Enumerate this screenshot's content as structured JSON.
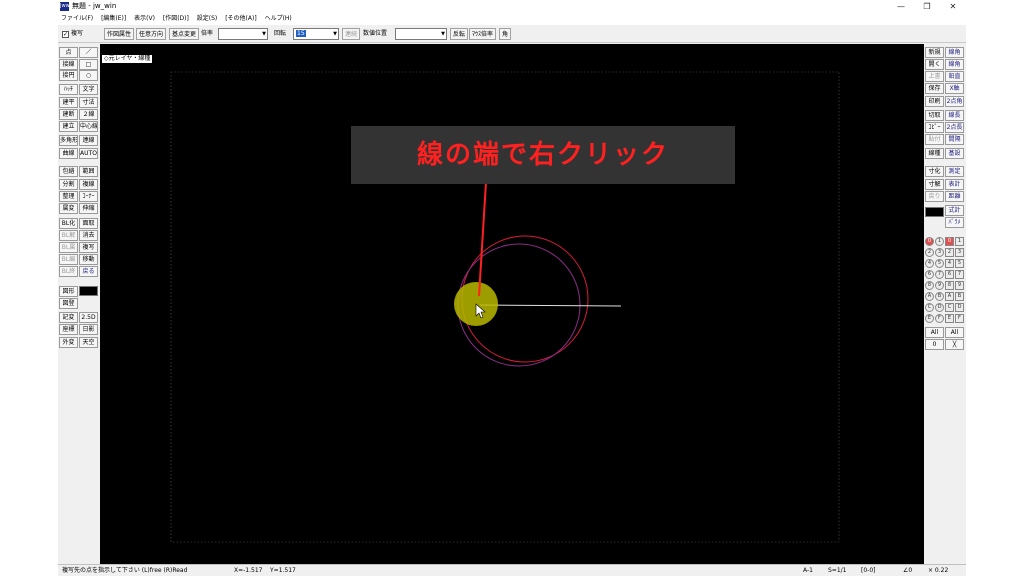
{
  "window": {
    "title": "無題 - jw_win",
    "app_icon": "Jww",
    "controls": [
      "—",
      "❐",
      "✕"
    ]
  },
  "menu": [
    "ファイル(F)",
    "[編集(E)]",
    "表示(V)",
    "[作図(D)]",
    "設定(S)",
    "[その他(A)]",
    "ヘルプ(H)"
  ],
  "toolbar": {
    "fukusha_label": "複写",
    "sakuzu_zokusei": "作図属性",
    "nini_houkou": "任意方向",
    "kiten_henkou": "基点変更",
    "bairitsu_label": "倍率",
    "bairitsu_value": "",
    "kaiten_label": "回転",
    "kaiten_value": "15",
    "renzoku": "連続",
    "suuchi_label": "数値位置",
    "suuchi_value": "",
    "hanten": "反転",
    "mouse_bairitsu": "ﾏｳｽ倍率",
    "kaku": "角"
  },
  "left_tools": [
    [
      "点",
      "／"
    ],
    [
      "接線",
      "□"
    ],
    [
      "接円",
      "○"
    ],
    [
      "ﾊｯﾁ",
      "文字"
    ],
    [
      "建平",
      "寸法"
    ],
    [
      "建断",
      "２線"
    ],
    [
      "建立",
      "中心線"
    ],
    [
      "多角形",
      "連線"
    ],
    [
      "曲線",
      "AUTO"
    ],
    [
      "包絡",
      "範囲"
    ],
    [
      "分割",
      "複線"
    ],
    [
      "整理",
      "ｺｰﾅｰ"
    ],
    [
      "属変",
      "伸縮"
    ],
    [
      "BL化",
      "面取"
    ],
    [
      "BL解",
      "消去"
    ],
    [
      "BL属",
      "複写"
    ],
    [
      "BL編",
      "移動"
    ],
    [
      "BL終",
      "戻る"
    ],
    [
      "図形",
      ""
    ],
    [
      "図登",
      ""
    ],
    [
      "記変",
      "2.5D"
    ],
    [
      "座標",
      "日影"
    ],
    [
      "外変",
      "天空"
    ]
  ],
  "right_tools": [
    [
      "新規",
      "線角"
    ],
    [
      "開く",
      "線角"
    ],
    [
      "上書",
      "鉛直"
    ],
    [
      "保存",
      "X軸"
    ],
    [
      "印刷",
      "2点角"
    ],
    [
      "切取",
      "線長"
    ],
    [
      "ｺﾋﾟｰ",
      "2点長"
    ],
    [
      "貼付",
      "間隔"
    ],
    [
      "線種",
      "基設"
    ],
    [
      "寸化",
      "測定"
    ],
    [
      "寸解",
      "表計"
    ],
    [
      "戻り",
      "距離"
    ],
    [
      "",
      "式計"
    ],
    [
      "",
      "ﾊﾟﾗﾒ"
    ]
  ],
  "layer_buttons": {
    "groups": [
      "0",
      "1",
      "2",
      "3",
      "4",
      "5",
      "6",
      "7",
      "8",
      "9",
      "A",
      "B",
      "C",
      "D",
      "E",
      "F"
    ],
    "all_left": "All",
    "all_right": "All",
    "zero": "0",
    "x_mark": "╳"
  },
  "canvas": {
    "layer_label": "◇元レイヤ・線種"
  },
  "annotation": {
    "text": "線の端で右クリック"
  },
  "status": {
    "message": "複写先の点を指示して下さい (L)free (R)Read",
    "x": "X=-1.517",
    "y": "Y=1.517",
    "paper": "A-1",
    "scale": "S=1/1",
    "layer": "[0-0]",
    "angle": "∠0",
    "zoom": "× 0.22"
  },
  "colors": {
    "canvas_bg": "#000000",
    "red_circle": "#d81b3b",
    "purple_circle": "#8a2e86",
    "line": "#e0e0e0",
    "highlight": "#b8b800",
    "annotation_text": "#ff2020",
    "annotation_bg": "#333333"
  }
}
